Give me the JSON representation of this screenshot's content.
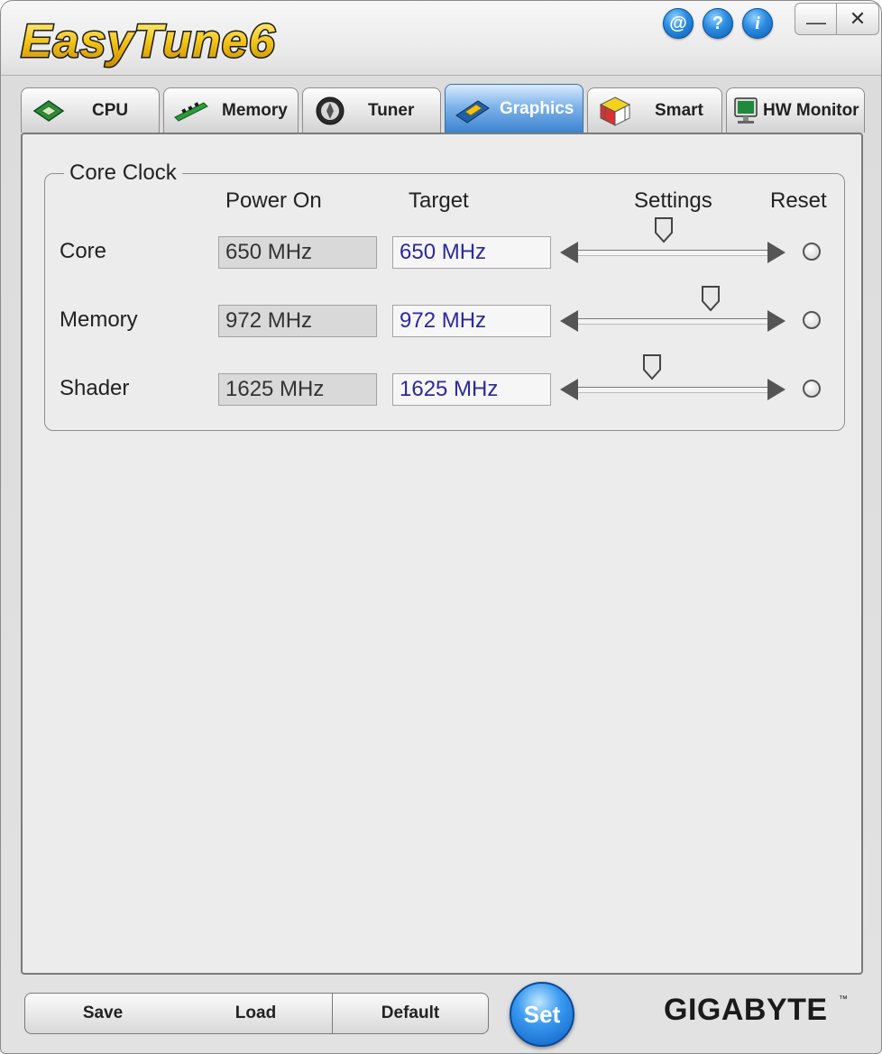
{
  "app": {
    "title": "EasyTune6",
    "brand": "GIGABYTE",
    "brand_tm": "™"
  },
  "title_bar": {
    "icons": [
      {
        "name": "web-icon",
        "glyph": "@"
      },
      {
        "name": "help-icon",
        "glyph": "?"
      },
      {
        "name": "info-icon",
        "glyph": "i"
      }
    ],
    "minimize_glyph": "—",
    "close_glyph": "✕"
  },
  "tabs": [
    {
      "label": "CPU",
      "icon": "cpu-chip-icon",
      "active": false
    },
    {
      "label": "Memory",
      "icon": "memory-module-icon",
      "active": false
    },
    {
      "label": "Tuner",
      "icon": "tuner-dial-icon",
      "active": false
    },
    {
      "label": "Graphics",
      "icon": "graphics-card-icon",
      "active": true
    },
    {
      "label": "Smart",
      "icon": "cube-icon",
      "active": false
    },
    {
      "label": "HW Monitor",
      "icon": "monitor-icon",
      "active": false
    }
  ],
  "core_clock": {
    "group_title": "Core Clock",
    "columns": {
      "power_on": "Power On",
      "target": "Target",
      "settings": "Settings",
      "reset": "Reset"
    },
    "rows": [
      {
        "label": "Core",
        "power_on": "650 MHz",
        "target": "650 MHz",
        "slider_position": 0.45
      },
      {
        "label": "Memory",
        "power_on": "972 MHz",
        "target": "972 MHz",
        "slider_position": 0.7
      },
      {
        "label": "Shader",
        "power_on": "1625 MHz",
        "target": "1625 MHz",
        "slider_position": 0.39
      }
    ]
  },
  "buttons": {
    "save": "Save",
    "load": "Load",
    "default": "Default",
    "set": "Set"
  },
  "colors": {
    "accent": "#2f7fd6",
    "target_text": "#2a2a9c"
  }
}
